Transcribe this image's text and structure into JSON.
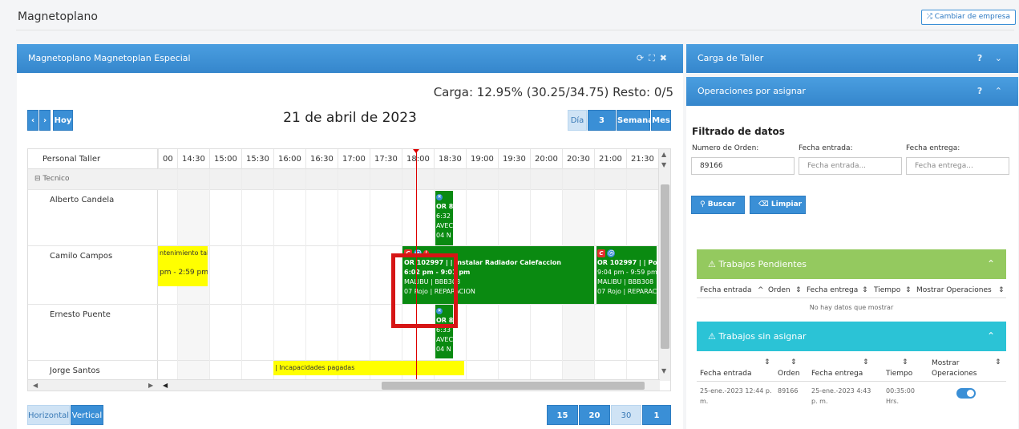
{
  "app": {
    "title": "Magnetoplano",
    "change_company": "⤮ Cambiar de empresa"
  },
  "main": {
    "title": "Magnetoplano Magnetoplan Especial",
    "carga": "Carga: 12.95% (30.25/34.75) Resto: 0/5",
    "date": "21 de abril de 2023",
    "nav": {
      "prev": "‹",
      "next": "›",
      "today": "Hoy"
    },
    "views": [
      "Día",
      "3 Días",
      "Semana",
      "Mes"
    ],
    "grid": {
      "column_label": "Personal Taller",
      "times": [
        "00",
        "14:30",
        "15:00",
        "15:30",
        "16:00",
        "16:30",
        "17:00",
        "17:30",
        "18:00",
        "18:30",
        "19:00",
        "19:30",
        "20:00",
        "20:30",
        "21:00",
        "21:30"
      ],
      "group": "⊟ Tecnico",
      "people": [
        "Alberto Candela",
        "Camilo Campos",
        "Ernesto Puente",
        "Jorge Santos"
      ]
    },
    "events": {
      "e1": {
        "l1": "OR 8",
        "l2": "6:32",
        "l3": "AVEC",
        "l4": "04 N"
      },
      "e2": {
        "l1": "OR 102997 | | Instalar Radiador Calefaccion",
        "l2": "6:02 pm - 9:01 pm",
        "l3": "MALIBU | BBB308",
        "l4": "07 Rojo | REPARACION"
      },
      "e3": {
        "l1": "OR 102997 | | Polea",
        "l2": "9:04 pm - 9:59 pm",
        "l3": "MALIBU | BBB308",
        "l4": "07 Rojo | REPARAC"
      },
      "e4": {
        "l1": "ntenimiento talle",
        "l2": "pm - 2:59 pm"
      },
      "e5": {
        "l1": "OR 8",
        "l2": "6:33",
        "l3": "AVEC",
        "l4": "04 N"
      },
      "e6": {
        "l1": "| Incapacidades pagadas"
      }
    },
    "orientation": [
      "Horizontal",
      "Vertical"
    ],
    "intervals": [
      "15 min.",
      "20 min.",
      "30 min.",
      "1 hora"
    ]
  },
  "side": {
    "carga_title": "Carga de Taller",
    "ops_title": "Operaciones por asignar",
    "help": "?",
    "filter": {
      "title": "Filtrado de datos",
      "order_label": "Numero de Orden:",
      "order_value": "89166",
      "entrada_label": "Fecha entrada:",
      "entrada_ph": "Fecha entrada...",
      "entrega_label": "Fecha entrega:",
      "entrega_ph": "Fecha entrega...",
      "search": "Buscar",
      "clear": "Limpiar"
    },
    "pendientes": {
      "title": "Trabajos Pendientes",
      "cols": [
        "Fecha entrada",
        "Orden",
        "Fecha entrega",
        "Tiempo",
        "Mostrar Operaciones"
      ],
      "empty": "No hay datos que mostrar"
    },
    "sin_asignar": {
      "title": "Trabajos sin asignar",
      "cols": [
        "Fecha entrada",
        "Orden",
        "Fecha entrega",
        "Tiempo",
        "Mostrar Operaciones"
      ],
      "row": {
        "entrada": "25-ene.-2023 12:44 p. m.",
        "orden": "89166",
        "entrega": "25-ene.-2023 4:43 p. m.",
        "tiempo": "00:35:00 Hrs."
      }
    }
  },
  "colors": {
    "accent": "#3a8fd6",
    "event_green": "#0a8a11",
    "event_yellow": "#ffff00",
    "pending_green": "#94c95f",
    "cyan": "#2bc3d6",
    "highlight_red": "#d61515"
  }
}
